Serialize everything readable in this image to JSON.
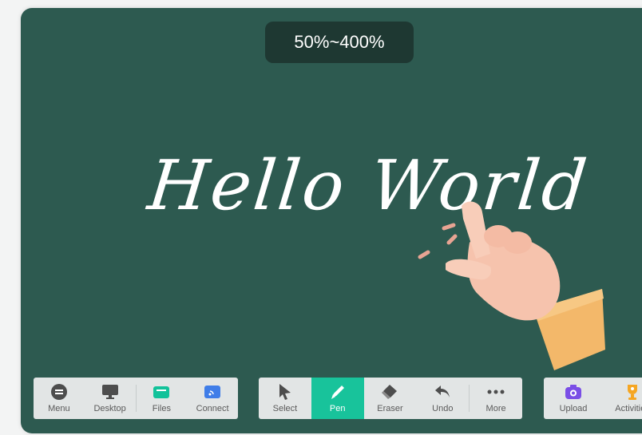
{
  "zoom": {
    "label": "50%~400%"
  },
  "board": {
    "handwriting": "Hello World"
  },
  "toolbar_left": [
    {
      "label": "Menu",
      "icon": "menu-icon"
    },
    {
      "label": "Desktop",
      "icon": "desktop-icon"
    },
    {
      "label": "Files",
      "icon": "folder-icon"
    },
    {
      "label": "Connect",
      "icon": "cast-icon"
    }
  ],
  "toolbar_mid": [
    {
      "label": "Select",
      "icon": "cursor-icon"
    },
    {
      "label": "Pen",
      "icon": "pen-icon",
      "active": true
    },
    {
      "label": "Eraser",
      "icon": "eraser-icon"
    },
    {
      "label": "Undo",
      "icon": "undo-icon"
    },
    {
      "label": "More",
      "icon": "more-icon"
    }
  ],
  "toolbar_right": [
    {
      "label": "Upload",
      "icon": "camera-icon"
    },
    {
      "label": "Activities",
      "icon": "trophy-icon"
    }
  ],
  "colors": {
    "board": "#2d5a50",
    "accent": "#18c39b",
    "toolbar": "#e2e5e5"
  }
}
